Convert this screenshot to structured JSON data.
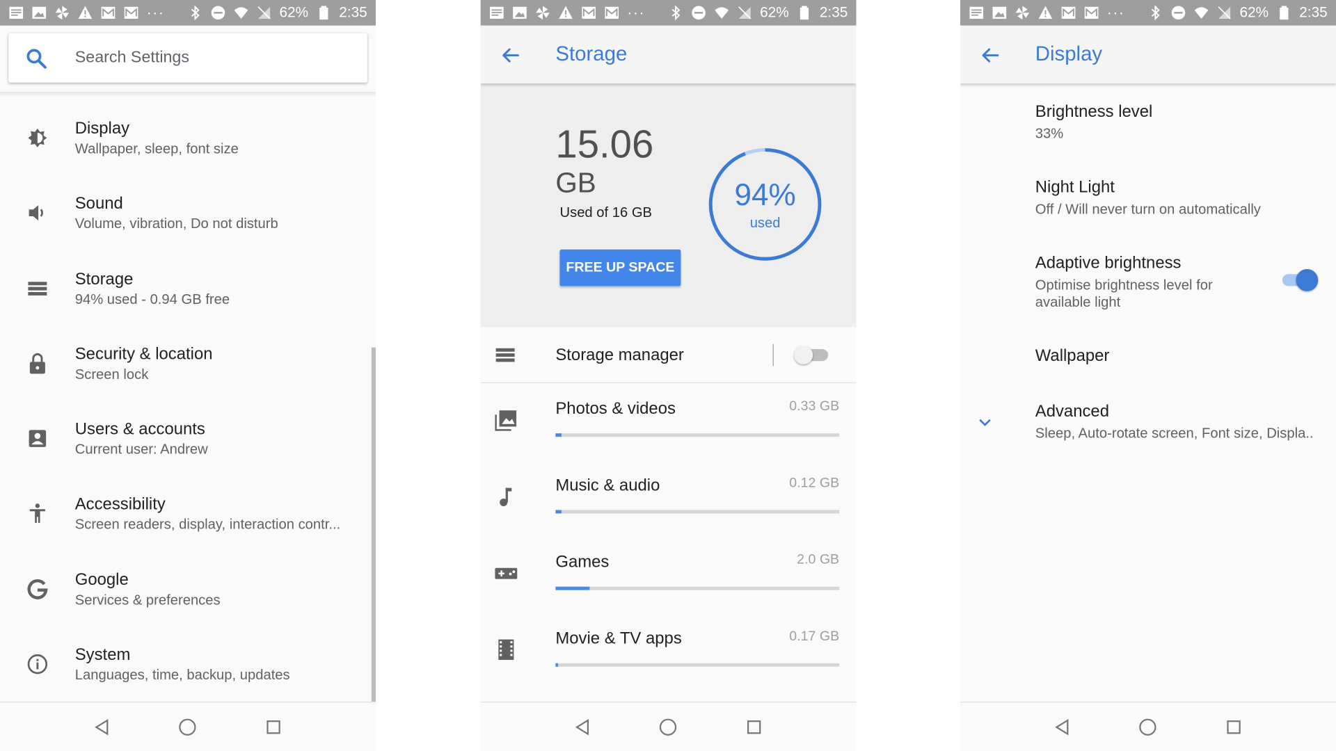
{
  "status_bar": {
    "battery": "62%",
    "time": "2:35",
    "overflow": "···"
  },
  "colors": {
    "accent": "#3b7bd6",
    "button": "#4286e9",
    "status_bar": "#9e9e9e"
  },
  "settings": {
    "search": {
      "placeholder": "Search Settings"
    },
    "items": [
      {
        "title": "Display",
        "subtitle": "Wallpaper, sleep, font size",
        "icon": "brightness-icon"
      },
      {
        "title": "Sound",
        "subtitle": "Volume, vibration, Do not disturb",
        "icon": "volume-icon"
      },
      {
        "title": "Storage",
        "subtitle": "94% used - 0.94 GB free",
        "icon": "storage-icon"
      },
      {
        "title": "Security & location",
        "subtitle": "Screen lock",
        "icon": "lock-icon"
      },
      {
        "title": "Users & accounts",
        "subtitle": "Current user: Andrew",
        "icon": "account-icon"
      },
      {
        "title": "Accessibility",
        "subtitle": "Screen readers, display, interaction contr...",
        "icon": "accessibility-icon"
      },
      {
        "title": "Google",
        "subtitle": "Services & preferences",
        "icon": "google-icon"
      },
      {
        "title": "System",
        "subtitle": "Languages, time, backup, updates",
        "icon": "info-icon"
      }
    ]
  },
  "storage": {
    "title": "Storage",
    "used_amount": "15.06",
    "used_unit": "GB",
    "used_of": "Used of 16 GB",
    "free_up_button": "FREE UP SPACE",
    "used_fraction": 0.94,
    "percent_label": "94%",
    "percent_caption": "used",
    "manager": {
      "label": "Storage manager",
      "enabled": false
    },
    "categories": [
      {
        "label": "Photos & videos",
        "size": "0.33 GB",
        "fraction": 0.02,
        "icon": "photo-icon"
      },
      {
        "label": "Music & audio",
        "size": "0.12 GB",
        "fraction": 0.0,
        "icon": "music-note-icon"
      },
      {
        "label": "Games",
        "size": "2.0 GB",
        "fraction": 0.12,
        "icon": "gamepad-icon"
      },
      {
        "label": "Movie & TV apps",
        "size": "0.17 GB",
        "fraction": 0.01,
        "icon": "film-icon"
      }
    ]
  },
  "display": {
    "title": "Display",
    "items": [
      {
        "title": "Brightness level",
        "subtitle": "33%"
      },
      {
        "title": "Night Light",
        "subtitle": "Off / Will never turn on automatically"
      },
      {
        "title": "Adaptive brightness",
        "subtitle": "Optimise brightness level for available light",
        "enabled": true
      },
      {
        "title": "Wallpaper",
        "subtitle": ""
      },
      {
        "title": "Advanced",
        "subtitle": "Sleep, Auto-rotate screen, Font size, Displa.."
      }
    ]
  }
}
